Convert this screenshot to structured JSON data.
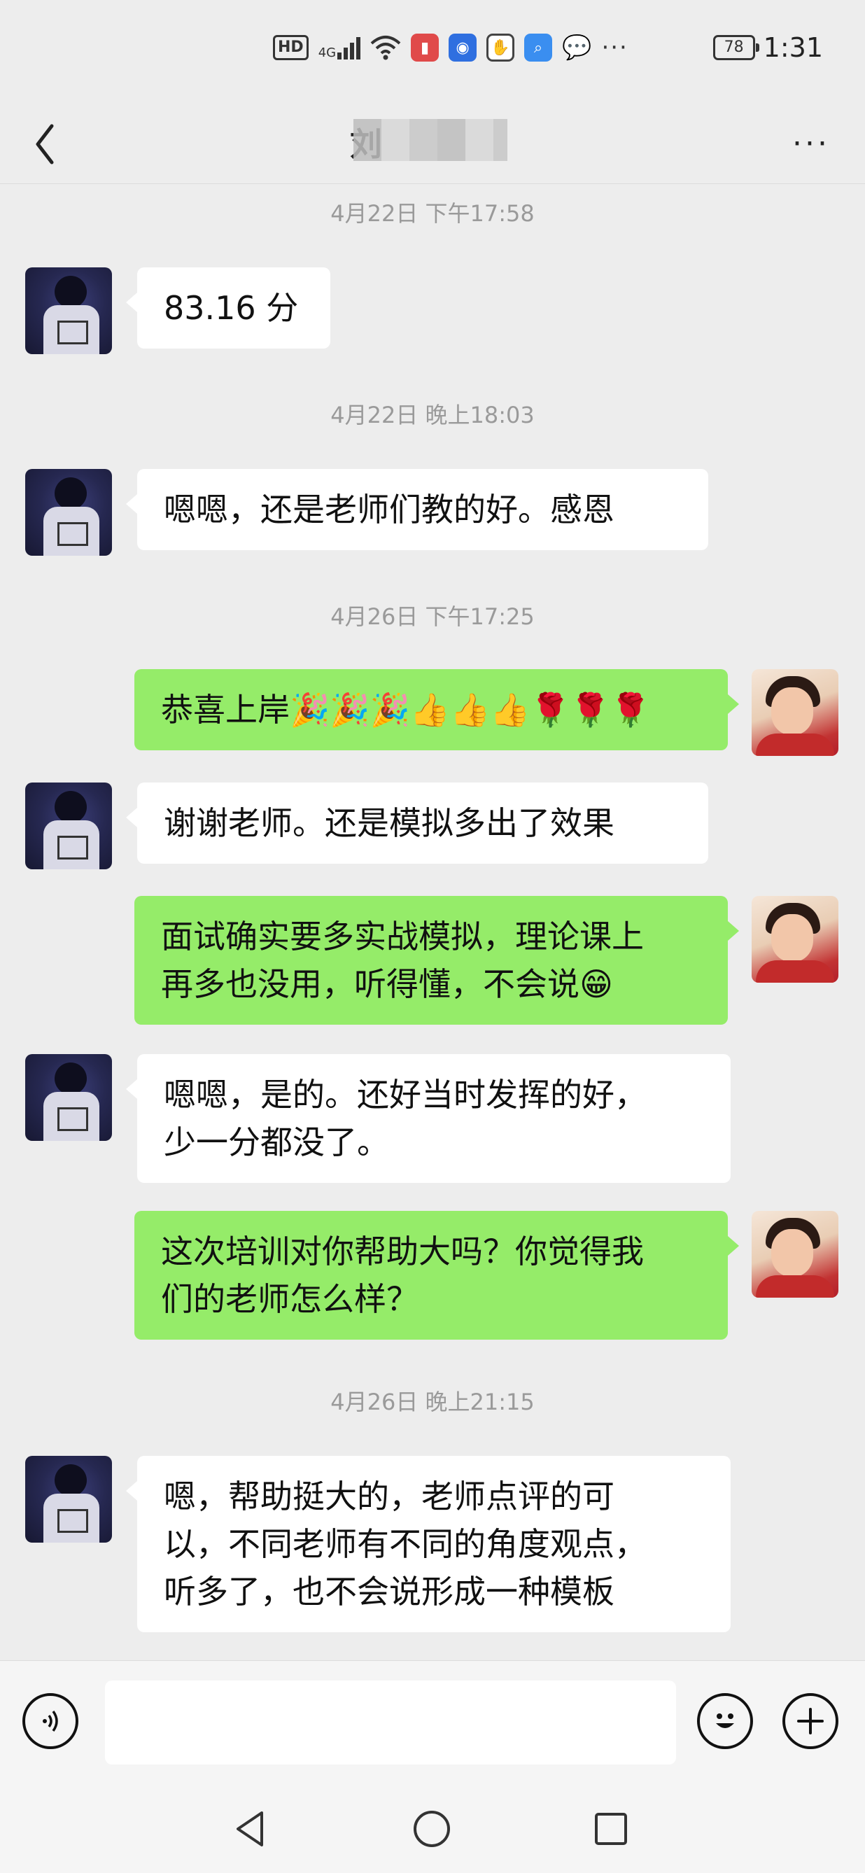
{
  "status_bar": {
    "hd": "HD",
    "network": "4G",
    "battery": "78",
    "time": "1:31",
    "more": "···",
    "app_icons": [
      "wifi-icon",
      "red-app-icon",
      "blue-app-icon",
      "hand-icon",
      "search-app-icon",
      "message-icon"
    ]
  },
  "header": {
    "back_icon": "chevron-left-icon",
    "title": "刘",
    "more": "···"
  },
  "messages": [
    {
      "type": "time",
      "text": "4月22日 下午17:58"
    },
    {
      "type": "in",
      "text": "83.16 分"
    },
    {
      "type": "time",
      "text": "4月22日 晚上18:03"
    },
    {
      "type": "in",
      "text": "嗯嗯，还是老师们教的好。感恩"
    },
    {
      "type": "time",
      "text": "4月26日 下午17:25"
    },
    {
      "type": "out",
      "text": "恭喜上岸🎉🎉🎉👍👍👍🌹🌹🌹"
    },
    {
      "type": "in",
      "text": "谢谢老师。还是模拟多出了效果"
    },
    {
      "type": "out",
      "text": "面试确实要多实战模拟，理论课上\n再多也没用，听得懂，不会说😁"
    },
    {
      "type": "in",
      "text": "嗯嗯，是的。还好当时发挥的好，\n少一分都没了。"
    },
    {
      "type": "out",
      "text": "这次培训对你帮助大吗？你觉得我\n们的老师怎么样？"
    },
    {
      "type": "time",
      "text": "4月26日 晚上21:15"
    },
    {
      "type": "in",
      "text": "嗯，帮助挺大的，老师点评的可\n以，不同老师有不同的角度观点，\n听多了，也不会说形成一种模板"
    }
  ],
  "input_bar": {
    "voice_icon": "voice-icon",
    "input_value": "",
    "emoji_icon": "emoji-icon",
    "plus_icon": "plus-icon"
  },
  "nav_bar": {
    "back": "triangle-back-icon",
    "home": "circle-home-icon",
    "recents": "square-recents-icon"
  },
  "colors": {
    "background": "#ededed",
    "incoming_bubble": "#ffffff",
    "outgoing_bubble": "#95ec69",
    "timestamp": "#9a9a9a"
  }
}
